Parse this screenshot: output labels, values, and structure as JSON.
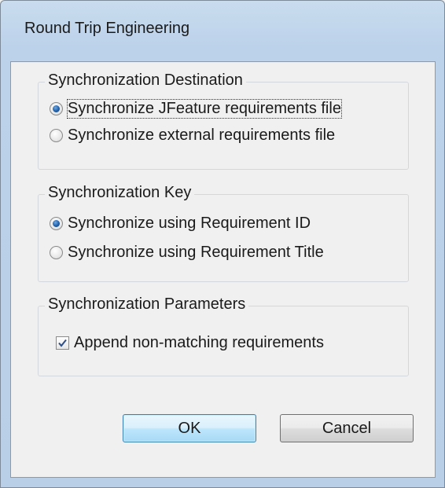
{
  "window": {
    "title": "Round Trip Engineering"
  },
  "groups": {
    "destination": {
      "legend": "Synchronization Destination",
      "options": [
        {
          "label": "Synchronize JFeature requirements file",
          "checked": true
        },
        {
          "label": "Synchronize external requirements file",
          "checked": false
        }
      ]
    },
    "key": {
      "legend": "Synchronization Key",
      "options": [
        {
          "label": "Synchronize using Requirement ID",
          "checked": true
        },
        {
          "label": "Synchronize using Requirement Title",
          "checked": false
        }
      ]
    },
    "parameters": {
      "legend": "Synchronization Parameters",
      "append_label": "Append non-matching requirements",
      "append_checked": true
    }
  },
  "buttons": {
    "ok_label": "OK",
    "cancel_label": "Cancel"
  }
}
